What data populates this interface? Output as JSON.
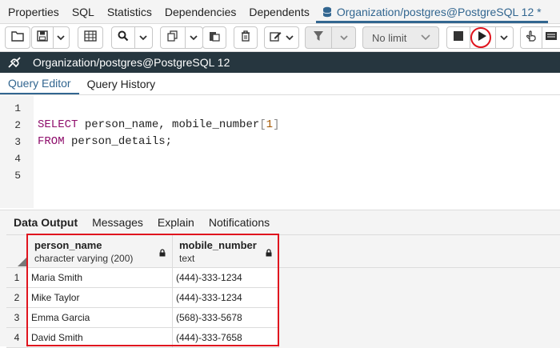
{
  "top_tabs": [
    {
      "label": "Properties"
    },
    {
      "label": "SQL"
    },
    {
      "label": "Statistics"
    },
    {
      "label": "Dependencies"
    },
    {
      "label": "Dependents"
    },
    {
      "label": "Organization/postgres@PostgreSQL 12 *",
      "active": true
    }
  ],
  "toolbar": {
    "limit_label": "No limit"
  },
  "connection": {
    "title": "Organization/postgres@PostgreSQL 12"
  },
  "query_tabs": [
    {
      "label": "Query Editor",
      "active": true
    },
    {
      "label": "Query History"
    }
  ],
  "editor": {
    "line_numbers": [
      "1",
      "2",
      "3",
      "4",
      "5"
    ],
    "line2": {
      "keyword": "SELECT",
      "text": " person_name, mobile_number",
      "open": "[",
      "index": "1",
      "close": "]"
    },
    "line3": {
      "keyword": "FROM",
      "text": " person_details;"
    }
  },
  "output_tabs": [
    {
      "label": "Data Output",
      "active": true
    },
    {
      "label": "Messages"
    },
    {
      "label": "Explain"
    },
    {
      "label": "Notifications"
    }
  ],
  "result_grid": {
    "columns": [
      {
        "name": "person_name",
        "type": "character varying (200)"
      },
      {
        "name": "mobile_number",
        "type": "text"
      }
    ],
    "rows": [
      {
        "n": "1",
        "person_name": "Maria Smith",
        "mobile_number": "(444)-333-1234"
      },
      {
        "n": "2",
        "person_name": "Mike Taylor",
        "mobile_number": "(444)-333-1234"
      },
      {
        "n": "3",
        "person_name": "Emma Garcia",
        "mobile_number": "(568)-333-5678"
      },
      {
        "n": "4",
        "person_name": "David Smith",
        "mobile_number": "(444)-333-7658"
      }
    ]
  },
  "colors": {
    "accent": "#326690",
    "titlebar": "#26363f",
    "highlight": "#e0141e",
    "keyword": "#8e0d6b",
    "number": "#a35700"
  }
}
